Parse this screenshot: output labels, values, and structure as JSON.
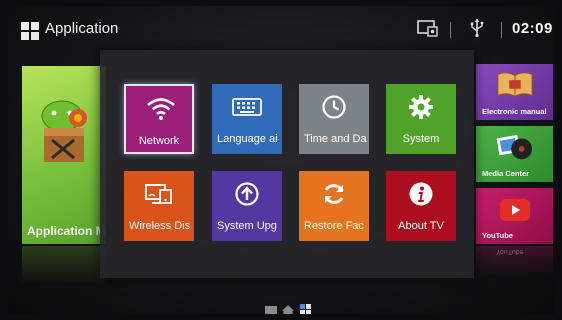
{
  "header": {
    "app_title": "Application",
    "clock": "02:09",
    "usb_glyph": "⭍"
  },
  "background_cards": {
    "left": {
      "label": "Application M"
    },
    "right": [
      {
        "label": "Electronic manual",
        "icon": "book-icon"
      },
      {
        "label": "Media Center",
        "icon": "media-icon"
      },
      {
        "label": "YouTube",
        "icon": "youtube-play-icon"
      }
    ],
    "reflection_text": "YouTube"
  },
  "settings_menu": {
    "tiles": [
      {
        "label": "Network",
        "icon": "wifi-icon",
        "color": "#9b1f78",
        "selected": true
      },
      {
        "label": "Language ai",
        "icon": "keyboard-icon",
        "color": "#2f6bb9"
      },
      {
        "label": "Time and Da",
        "icon": "clock-icon",
        "color": "#7d8489"
      },
      {
        "label": "System",
        "icon": "gear-icon",
        "color": "#4fa329"
      },
      {
        "label": "Wireless Dis",
        "icon": "cast-screen-icon",
        "color": "#d9531b"
      },
      {
        "label": "System Upg",
        "icon": "upgrade-arrow-icon",
        "color": "#5438a1"
      },
      {
        "label": "Restore Fac",
        "icon": "refresh-icon",
        "color": "#e6731f"
      },
      {
        "label": "About TV",
        "icon": "info-icon",
        "color": "#ad0e1f"
      }
    ]
  }
}
